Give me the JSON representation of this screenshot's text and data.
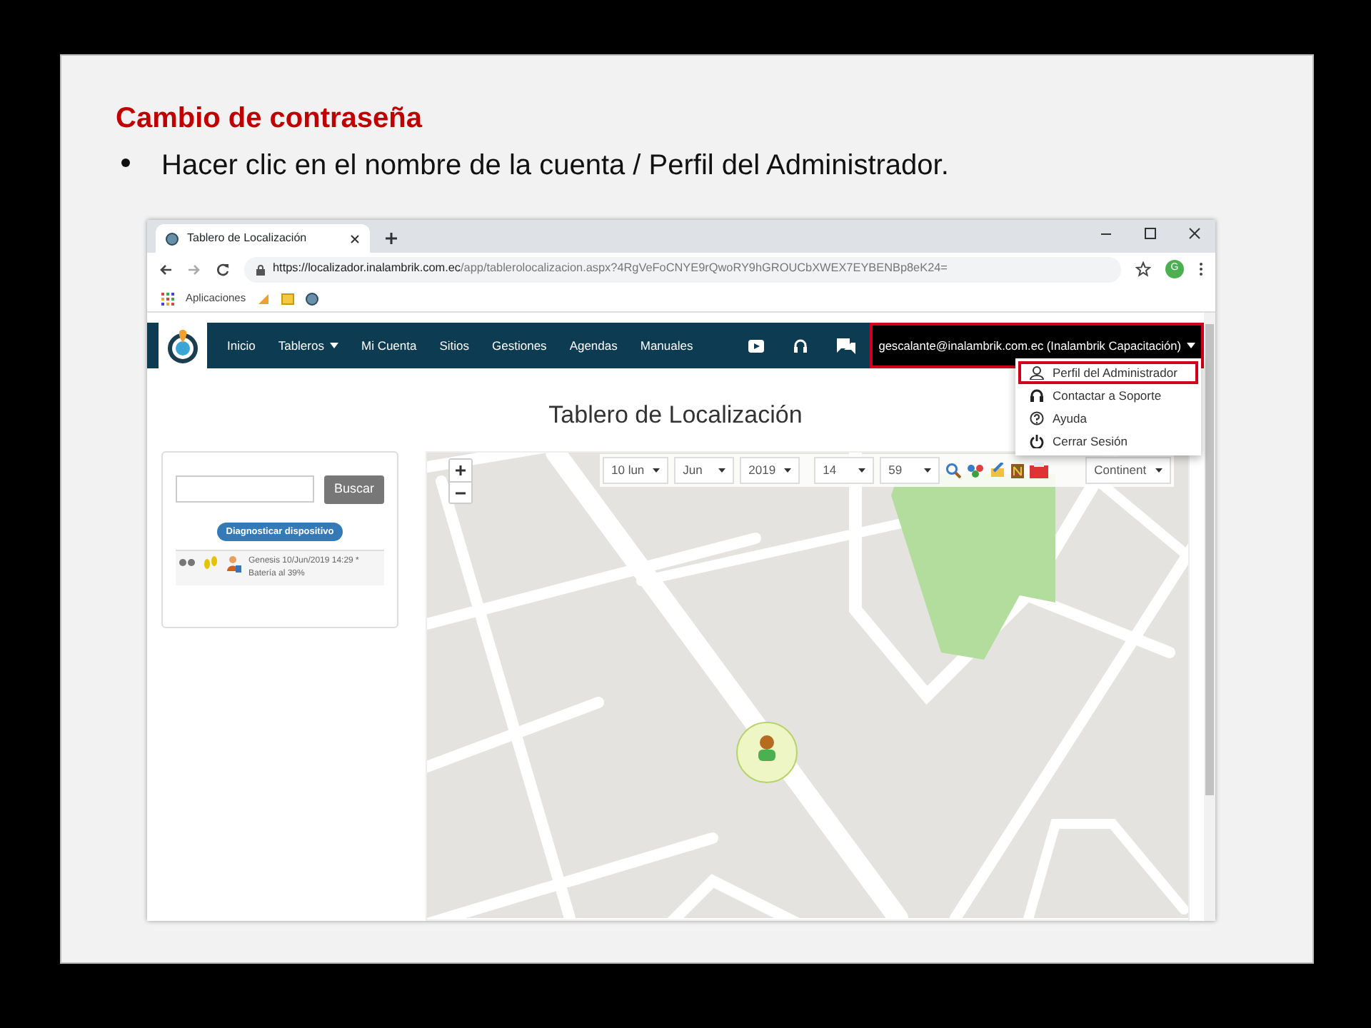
{
  "slide": {
    "title": "Cambio de contraseña",
    "bullets": [
      "Hacer clic en el nombre de la cuenta / Perfil del Administrador."
    ]
  },
  "browser": {
    "tab_title": "Tablero de Localización",
    "url_host": "https://localizador.inalambrik.com.ec",
    "url_path": "/app/tablerolocalizacion.aspx?4RgVeFoCNYE9rQwoRY9hGROUCbXWEX7EYBENBp8eK24=",
    "profile_initial": "G",
    "bookmarks": [
      "Aplicaciones"
    ]
  },
  "navbar": {
    "items": [
      {
        "label": "Inicio",
        "dropdown": false
      },
      {
        "label": "Tableros",
        "dropdown": true
      },
      {
        "label": "Mi Cuenta",
        "dropdown": false
      },
      {
        "label": "Sitios",
        "dropdown": false
      },
      {
        "label": "Gestiones",
        "dropdown": false
      },
      {
        "label": "Agendas",
        "dropdown": false
      },
      {
        "label": "Manuales",
        "dropdown": false
      }
    ],
    "account": {
      "label": "gescalante@inalambrik.com.ec (Inalambrik Capacitación)",
      "highlighted": true
    },
    "menu": [
      {
        "label": "Perfil del Administrador",
        "kind": "user",
        "highlighted": true
      },
      {
        "label": "Contactar a Soporte",
        "kind": "support",
        "highlighted": false
      },
      {
        "label": "Ayuda",
        "kind": "help",
        "highlighted": false
      },
      {
        "label": "Cerrar Sesión",
        "kind": "power",
        "highlighted": false
      }
    ]
  },
  "page": {
    "title": "Tablero de Localización"
  },
  "search": {
    "button": "Buscar"
  },
  "diagnose_button": "Diagnosticar dispositivo",
  "devices": [
    {
      "lines": [
        "Genesis 10/Jun/2019 14:29 *",
        "Batería al 39%"
      ]
    }
  ],
  "map": {
    "selects": [
      "10 lun",
      "Jun",
      "2019",
      "14",
      "59"
    ],
    "layer_select": "Continent"
  }
}
